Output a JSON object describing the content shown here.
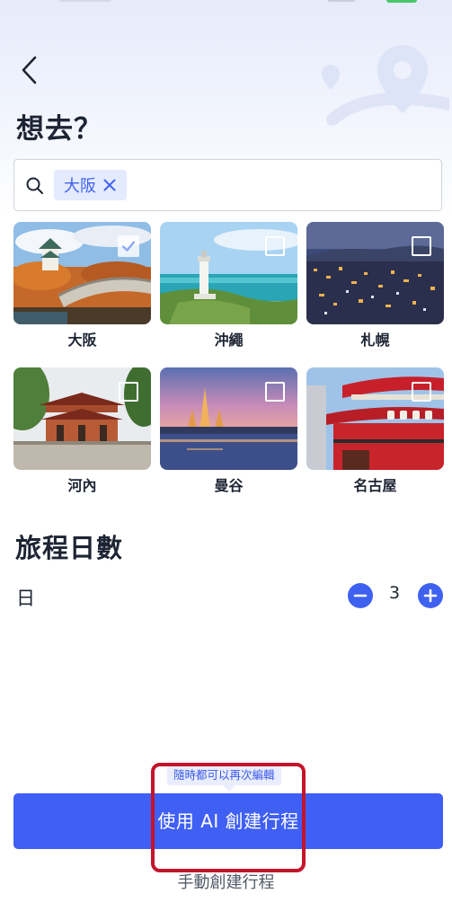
{
  "header": {
    "title": "想去？"
  },
  "search": {
    "chips": [
      {
        "label": "大阪"
      }
    ]
  },
  "destinations": [
    {
      "name": "大阪",
      "checked": true
    },
    {
      "name": "沖繩",
      "checked": false
    },
    {
      "name": "札幌",
      "checked": false
    },
    {
      "name": "河內",
      "checked": false
    },
    {
      "name": "曼谷",
      "checked": false
    },
    {
      "name": "名古屋",
      "checked": false
    }
  ],
  "duration": {
    "title": "旅程日數",
    "unit": "日",
    "value": "3"
  },
  "actions": {
    "hint": "隨時都可以再次編輯",
    "ai_create": "使用 AI 創建行程",
    "manual_create": "手動創建行程"
  },
  "colors": {
    "accent": "#3f5ff5",
    "chip_bg": "#e4ebff",
    "highlight": "#c4142b"
  },
  "icons": {
    "back": "chevron-left-icon",
    "search": "search-icon",
    "chip_close": "close-icon",
    "minus": "minus-circle-icon",
    "plus": "plus-circle-icon",
    "checkbox": "checkbox-icon"
  }
}
